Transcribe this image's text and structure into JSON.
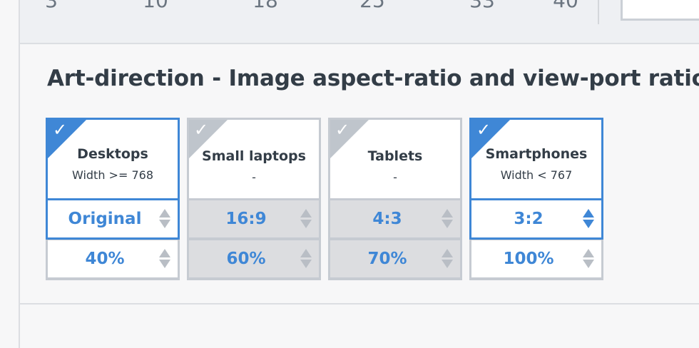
{
  "top_scale": {
    "ticks": [
      "3",
      "10",
      "18",
      "25",
      "33",
      "40"
    ]
  },
  "section": {
    "title": "Art-direction - Image aspect-ratio and view-port ratio"
  },
  "colors": {
    "accent": "#3f87d6",
    "text": "#333d47",
    "inactive_corner": "#bfc5cc"
  },
  "cards": [
    {
      "name": "Desktops",
      "desc": "Width >= 768",
      "selected": true,
      "ratio": "Original",
      "size": "40%",
      "check_icon": "checkmark-icon"
    },
    {
      "name": "Small laptops",
      "desc": "-",
      "selected": false,
      "ratio": "16:9",
      "size": "60%",
      "check_icon": "checkmark-icon"
    },
    {
      "name": "Tablets",
      "desc": "-",
      "selected": false,
      "ratio": "4:3",
      "size": "70%",
      "check_icon": "checkmark-icon"
    },
    {
      "name": "Smartphones",
      "desc": "Width < 767",
      "selected": true,
      "ratio": "3:2",
      "size": "100%",
      "check_icon": "checkmark-icon"
    }
  ]
}
